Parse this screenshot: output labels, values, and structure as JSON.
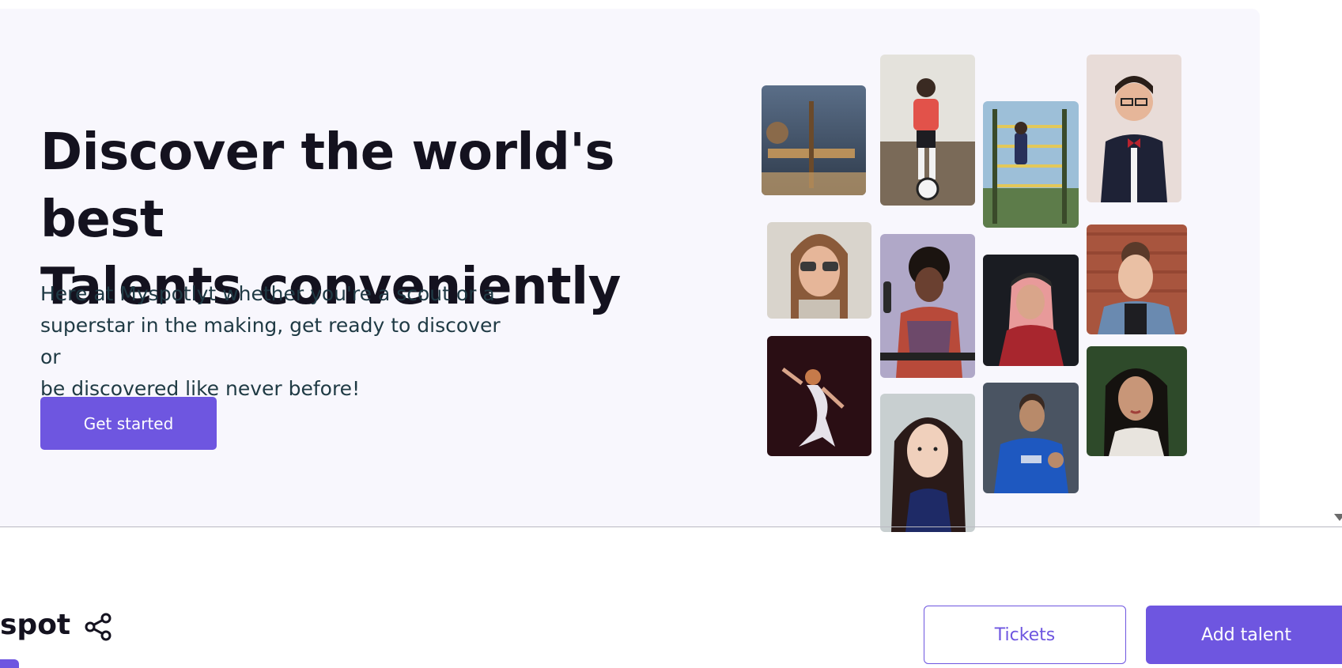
{
  "hero": {
    "title_line1": "Discover the world's best",
    "title_line2": "Talents conveniently",
    "subtitle_line1": "Here at Myspotlyt whether you're a scout or a",
    "subtitle_line2": "superstar in the making, get ready to discover or",
    "subtitle_line3": "be discovered like never before!",
    "cta_label": "Get started"
  },
  "footer": {
    "brand_text": "spot",
    "tickets_label": "Tickets",
    "add_talent_label": "Add talent"
  },
  "colors": {
    "accent": "#6e56e0",
    "hero_bg": "#f8f7fd",
    "heading": "#14121f",
    "body_text": "#1f3a44"
  },
  "icons": [
    "share-icon",
    "scroll-down-icon"
  ]
}
